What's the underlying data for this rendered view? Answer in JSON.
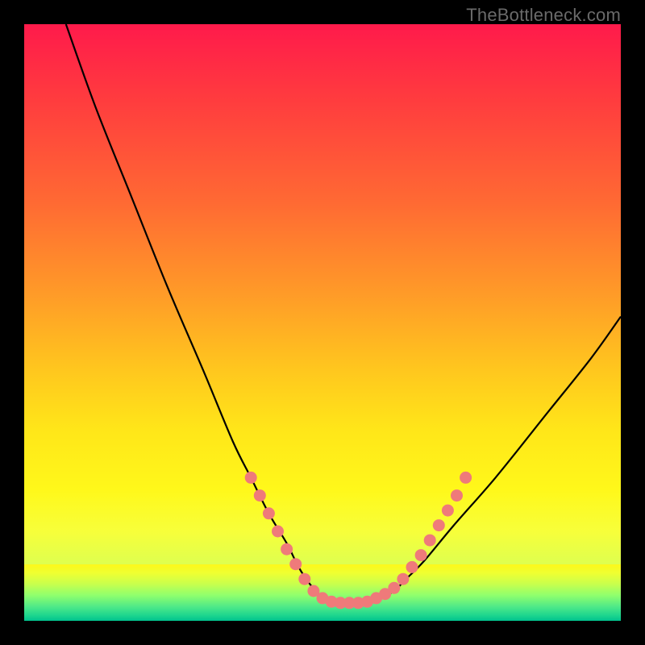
{
  "watermark": "TheBottleneck.com",
  "chart_data": {
    "type": "line",
    "title": "",
    "xlabel": "",
    "ylabel": "",
    "xlim": [
      0,
      100
    ],
    "ylim": [
      0,
      100
    ],
    "grid": false,
    "legend": false,
    "series": [
      {
        "name": "bottleneck-curve",
        "x": [
          7,
          12,
          18,
          24,
          30,
          35,
          38,
          41,
          44,
          46,
          48,
          50,
          52,
          54,
          56,
          58,
          60,
          62,
          64,
          67,
          72,
          79,
          87,
          95,
          100
        ],
        "y": [
          100,
          86,
          71,
          56,
          42,
          30,
          24,
          18,
          13,
          9,
          6,
          4,
          3,
          3,
          3,
          3,
          4,
          5,
          7,
          10,
          16,
          24,
          34,
          44,
          51
        ]
      }
    ],
    "markers": {
      "name": "highlight-dots",
      "color": "#ef7a7a",
      "points": [
        {
          "x": 38.0,
          "y": 24.0
        },
        {
          "x": 39.5,
          "y": 21.0
        },
        {
          "x": 41.0,
          "y": 18.0
        },
        {
          "x": 42.5,
          "y": 15.0
        },
        {
          "x": 44.0,
          "y": 12.0
        },
        {
          "x": 45.5,
          "y": 9.5
        },
        {
          "x": 47.0,
          "y": 7.0
        },
        {
          "x": 48.5,
          "y": 5.0
        },
        {
          "x": 50.0,
          "y": 3.8
        },
        {
          "x": 51.5,
          "y": 3.2
        },
        {
          "x": 53.0,
          "y": 3.0
        },
        {
          "x": 54.5,
          "y": 3.0
        },
        {
          "x": 56.0,
          "y": 3.0
        },
        {
          "x": 57.5,
          "y": 3.2
        },
        {
          "x": 59.0,
          "y": 3.8
        },
        {
          "x": 60.5,
          "y": 4.5
        },
        {
          "x": 62.0,
          "y": 5.5
        },
        {
          "x": 63.5,
          "y": 7.0
        },
        {
          "x": 65.0,
          "y": 9.0
        },
        {
          "x": 66.5,
          "y": 11.0
        },
        {
          "x": 68.0,
          "y": 13.5
        },
        {
          "x": 69.5,
          "y": 16.0
        },
        {
          "x": 71.0,
          "y": 18.5
        },
        {
          "x": 72.5,
          "y": 21.0
        },
        {
          "x": 74.0,
          "y": 24.0
        }
      ]
    },
    "background": {
      "type": "vertical-gradient",
      "stops": [
        {
          "pos": 0.0,
          "color": "#ff1a4b"
        },
        {
          "pos": 0.3,
          "color": "#ff6a33"
        },
        {
          "pos": 0.58,
          "color": "#ffc71e"
        },
        {
          "pos": 0.78,
          "color": "#fff81a"
        },
        {
          "pos": 0.96,
          "color": "#8fff6e"
        },
        {
          "pos": 1.0,
          "color": "#00c98f"
        }
      ]
    }
  }
}
